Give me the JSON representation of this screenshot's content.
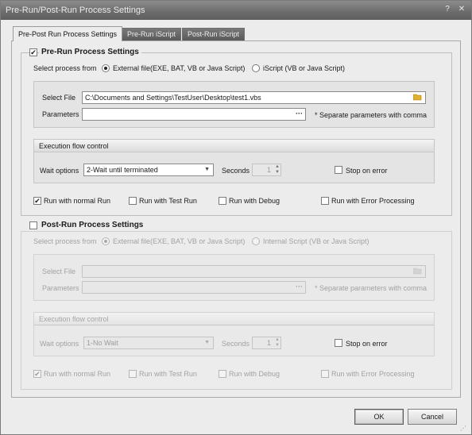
{
  "window": {
    "title": "Pre-Run/Post-Run Process Settings",
    "help_glyph": "?",
    "close_glyph": "✕"
  },
  "tabs": [
    {
      "label": "Pre-Post Run Process Settings"
    },
    {
      "label": "Pre-Run iScript"
    },
    {
      "label": "Post-Run iScript"
    }
  ],
  "pre": {
    "enabled_check": "✔",
    "title": "Pre-Run Process Settings",
    "select_from_label": "Select process from",
    "option_external": "External file(EXE, BAT, VB or Java Script)",
    "option_iscript": "iScript (VB or Java Script)",
    "select_file_label": "Select File",
    "select_file_value": "C:\\Documents and Settings\\TestUser\\Desktop\\test1.vbs",
    "parameters_label": "Parameters",
    "parameters_value": "",
    "params_more": "···",
    "params_hint": "* Separate parameters with comma",
    "flow_title": "Execution flow control",
    "wait_label": "Wait options",
    "wait_value": "2-Wait until terminated",
    "seconds_label": "Seconds",
    "seconds_value": "1",
    "stop_on_error": "Stop on error",
    "normal_run_check": "✔",
    "normal_run": "Run with normal Run",
    "test_run": "Run with Test Run",
    "debug_run": "Run with Debug",
    "error_run": "Run with Error Processing"
  },
  "post": {
    "title": "Post-Run Process Settings",
    "select_from_label": "Select process from",
    "option_external": "External file(EXE, BAT, VB or Java Script)",
    "option_internal": "Internal Script (VB or Java Script)",
    "select_file_label": "Select File",
    "select_file_value": "",
    "parameters_label": "Parameters",
    "parameters_value": "",
    "params_more": "···",
    "params_hint": "* Separate parameters with comma",
    "flow_title": "Execution flow control",
    "wait_label": "Wait options",
    "wait_value": "1-No Wait",
    "seconds_label": "Seconds",
    "seconds_value": "1",
    "stop_on_error": "Stop on error",
    "normal_run_check": "✔",
    "normal_run": "Run with normal Run",
    "test_run": "Run with Test Run",
    "debug_run": "Run with Debug",
    "error_run": "Run with Error Processing"
  },
  "buttons": {
    "ok": "OK",
    "cancel": "Cancel"
  },
  "colors": {
    "titlebar": "#6e6e6e",
    "folder_icon": "#e0b030",
    "inactive_tab": "#5a5a5a"
  }
}
